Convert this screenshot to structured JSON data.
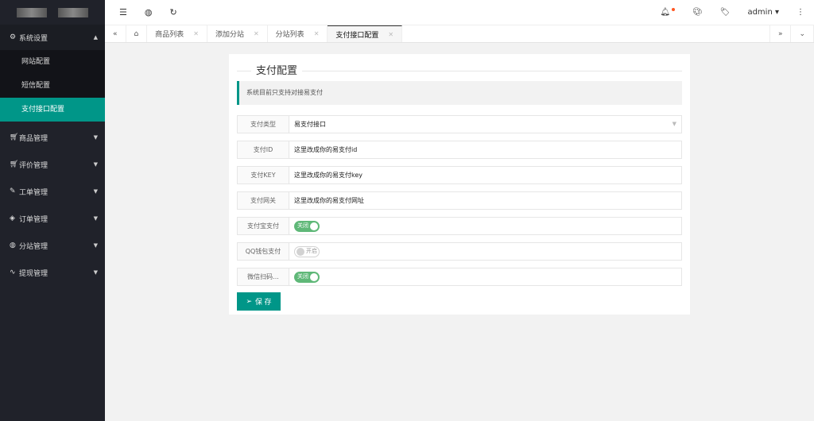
{
  "sidebar": {
    "groups": [
      {
        "label": "系统设置",
        "icon": "gear-icon",
        "expanded": true,
        "items": [
          {
            "label": "网站配置"
          },
          {
            "label": "短信配置"
          },
          {
            "label": "支付接口配置",
            "active": true
          }
        ]
      },
      {
        "label": "商品管理",
        "icon": "cart-icon"
      },
      {
        "label": "评价管理",
        "icon": "cart-icon"
      },
      {
        "label": "工单管理",
        "icon": "edit-icon"
      },
      {
        "label": "订单管理",
        "icon": "layers-icon"
      },
      {
        "label": "分站管理",
        "icon": "globe-icon"
      },
      {
        "label": "提现管理",
        "icon": "pulse-icon"
      }
    ]
  },
  "header": {
    "user": "admin"
  },
  "tabs": [
    {
      "label": "商品列表"
    },
    {
      "label": "添加分站"
    },
    {
      "label": "分站列表"
    },
    {
      "label": "支付接口配置",
      "active": true
    }
  ],
  "card": {
    "title": "支付配置",
    "note": "系统目前只支持对接易支付",
    "fields": [
      {
        "label": "支付类型",
        "value": "易支付接口"
      },
      {
        "label": "支付ID",
        "value": "这里改成你的易支付id"
      },
      {
        "label": "支付KEY",
        "value": "这里改成你的易支付key"
      },
      {
        "label": "支付网关",
        "value": "这里改成你的易支付网址"
      }
    ],
    "switches": [
      {
        "label": "支付宝支付",
        "text": "关闭",
        "on": true
      },
      {
        "label": "QQ钱包支付",
        "text": "开启",
        "on": false
      },
      {
        "label": "微信扫码...",
        "text": "关闭",
        "on": true
      }
    ],
    "save": "保 存"
  },
  "colors": {
    "accent": "#009688",
    "sidebar": "#20222a",
    "switch_on": "#5fb878",
    "badge": "#ff5722"
  }
}
